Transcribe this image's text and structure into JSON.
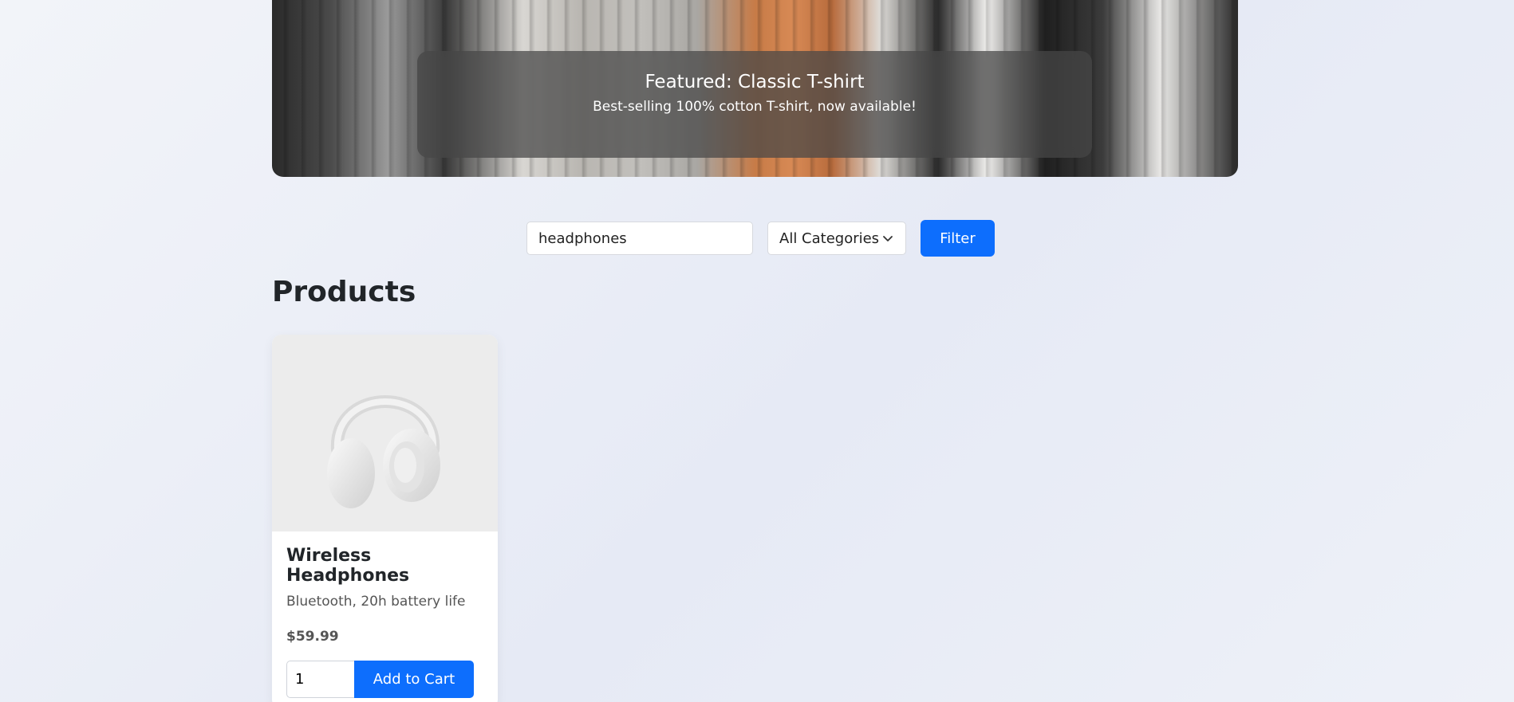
{
  "hero": {
    "title": "Featured: Classic T-shirt",
    "subtitle": "Best-selling 100% cotton T-shirt, now available!"
  },
  "filter": {
    "search_value": "headphones",
    "category_selected": "All Categories",
    "filter_label": "Filter"
  },
  "products": {
    "heading": "Products",
    "items": [
      {
        "name": "Wireless Headphones",
        "description": "Bluetooth, 20h battery life",
        "price": "$59.99",
        "quantity": "1",
        "add_label": "Add to Cart"
      }
    ]
  },
  "colors": {
    "accent": "#0d6efd",
    "page_bg": "#eef1f8"
  }
}
